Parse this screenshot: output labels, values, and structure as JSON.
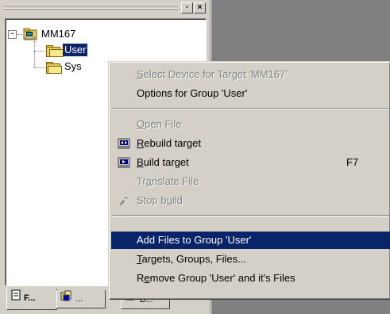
{
  "panel": {
    "buttons": {
      "maximize": "▫",
      "close": "×"
    }
  },
  "tree": {
    "root": {
      "label": "MM167",
      "expander": "−"
    },
    "children": [
      {
        "label": "User",
        "selected": true
      },
      {
        "label": "Sys"
      }
    ]
  },
  "tabs": [
    {
      "label": "F...",
      "icon": "files-icon",
      "active": true
    },
    {
      "label": "...",
      "icon": "books-icon",
      "active": false
    },
    {
      "label": "B...",
      "icon": "functions-icon",
      "active": false
    }
  ],
  "menu": {
    "items": [
      {
        "label": "Select Device for Target 'MM167'",
        "mnemonic": "S",
        "enabled": false
      },
      {
        "label": "Options for Group 'User'",
        "enabled": true
      },
      {
        "separator": true
      },
      {
        "label": "Open File",
        "mnemonic": "O",
        "enabled": false
      },
      {
        "label": "Rebuild target",
        "mnemonic": "R",
        "enabled": true,
        "icon": "rebuild-icon"
      },
      {
        "label": "Build target",
        "mnemonic": "B",
        "enabled": true,
        "icon": "build-icon",
        "shortcut": "F7"
      },
      {
        "label": "Translate File",
        "mnemonic": "a",
        "enabled": false
      },
      {
        "label": "Stop build",
        "mnemonic": "u",
        "enabled": false,
        "icon": "stop-build-icon"
      },
      {
        "separator": true
      },
      {
        "label": "Add Files to Group 'User'",
        "enabled": true,
        "highlighted": true
      },
      {
        "label": "Targets, Groups, Files...",
        "mnemonic": "T",
        "enabled": true
      },
      {
        "label": "Remove Group 'User' and it's Files",
        "mnemonic": "e",
        "enabled": true
      }
    ]
  },
  "colors": {
    "highlight": "#0a246a",
    "face": "#d4d0c8",
    "workspace": "#808080"
  }
}
